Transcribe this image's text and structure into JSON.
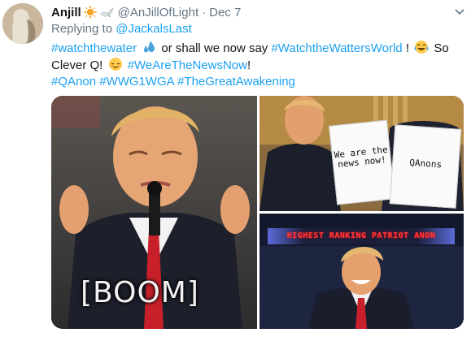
{
  "tweet": {
    "author_name": "Anjill",
    "author_handle": "@AnJillOfLight",
    "separator": "·",
    "date": "Dec 7",
    "reply_prefix": "Replying to",
    "reply_handle": "@JackalsLast",
    "line1_tag1": "#watchthewater",
    "line1_text1": " or shall we now say ",
    "line1_tag2": "#WatchtheWattersWorld",
    "line1_text2": "! ",
    "line1_text3": " So",
    "line2_text1": "Clever Q! ",
    "line2_tag": "#WeAreTheNewsNow",
    "line2_text2": "!",
    "line3_tag1": "#QAnon",
    "line3_tag2": "#WWG1WGA",
    "line3_tag3": "#TheGreatAwakening"
  },
  "icons": {
    "name_emoji1": "sun-emoji",
    "name_emoji2": "dove-emoji",
    "droplets": "sweat-droplets-emoji",
    "laugh": "tears-of-joy-emoji",
    "smirk": "relieved-face-emoji",
    "menu": "chevron-down-icon"
  },
  "media": {
    "image1_caption": "[BOOM]",
    "image2_left_doc": "We are the news now!",
    "image2_right_doc": "QAnons",
    "image3_banner": "HIGHEST RANKING PATRIOT ANON"
  },
  "colors": {
    "link": "#1da1f2",
    "muted": "#657786",
    "text": "#14171a"
  }
}
